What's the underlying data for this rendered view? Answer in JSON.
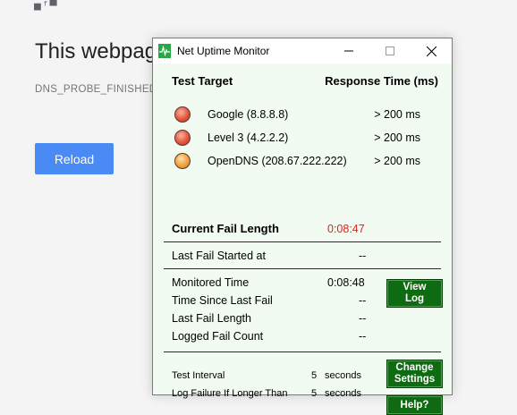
{
  "background": {
    "dino_text": "■ᶠ▀",
    "title": "This webpag",
    "error_code": "DNS_PROBE_FINISHED_",
    "reload_label": "Reload"
  },
  "window": {
    "title": "Net Uptime Monitor",
    "controls": {
      "minimize": "—",
      "maximize": "☐",
      "close": "✕"
    }
  },
  "headers": {
    "target": "Test Target",
    "response": "Response Time (ms)"
  },
  "targets": [
    {
      "name": "Google (8.8.8.8)",
      "response": "> 200 ms",
      "status_color": "red"
    },
    {
      "name": "Level 3 (4.2.2.2)",
      "response": "> 200 ms",
      "status_color": "red"
    },
    {
      "name": "OpenDNS (208.67.222.222)",
      "response": "> 200 ms",
      "status_color": "orange"
    }
  ],
  "current_fail": {
    "label": "Current Fail Length",
    "value": "0:08:47"
  },
  "last_fail_started": {
    "label": "Last Fail Started at",
    "value": "--"
  },
  "stats": [
    {
      "label": "Monitored Time",
      "value": "0:08:48"
    },
    {
      "label": "Time Since Last Fail",
      "value": "--"
    },
    {
      "label": "Last Fail Length",
      "value": "--"
    },
    {
      "label": "Logged Fail Count",
      "value": "--"
    }
  ],
  "settings": {
    "interval_label": "Test Interval",
    "interval_value": "5",
    "interval_unit": "seconds",
    "log_label": "Log Failure If Longer Than",
    "log_value": "5",
    "log_unit": "seconds"
  },
  "buttons": {
    "view_log": "View\nLog",
    "change_settings": "Change\nSettings",
    "help": "Help?"
  },
  "colors": {
    "window_bg": "#f2fbf1",
    "button_green": "#0f6b12",
    "fail_red": "#e0201b",
    "reload_blue": "#4a8af4"
  }
}
